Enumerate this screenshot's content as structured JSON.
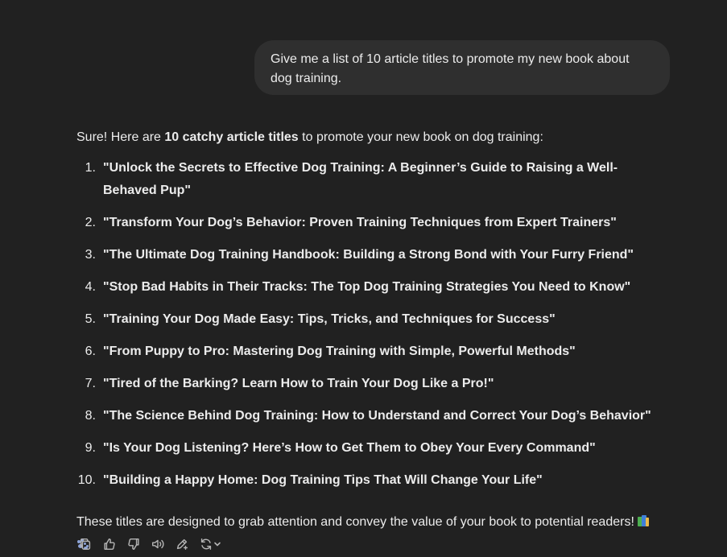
{
  "conversation": {
    "user_message": "Give me a list of 10 article titles to promote my new book about dog training.",
    "assistant": {
      "intro_prefix": "Sure! Here are ",
      "intro_bold": "10 catchy article titles",
      "intro_suffix": " to promote your new book on dog training:",
      "titles": [
        {
          "num": "1.",
          "text": "\"Unlock the Secrets to Effective Dog Training: A Beginner’s Guide to Raising a Well-Behaved Pup\""
        },
        {
          "num": "2.",
          "text": "\"Transform Your Dog’s Behavior: Proven Training Techniques from Expert Trainers\""
        },
        {
          "num": "3.",
          "text": "\"The Ultimate Dog Training Handbook: Building a Strong Bond with Your Furry Friend\""
        },
        {
          "num": "4.",
          "text": "\"Stop Bad Habits in Their Tracks: The Top Dog Training Strategies You Need to Know\""
        },
        {
          "num": "5.",
          "text": "\"Training Your Dog Made Easy: Tips, Tricks, and Techniques for Success\""
        },
        {
          "num": "6.",
          "text": "\"From Puppy to Pro: Mastering Dog Training with Simple, Powerful Methods\""
        },
        {
          "num": "7.",
          "text": "\"Tired of the Barking? Learn How to Train Your Dog Like a Pro!\""
        },
        {
          "num": "8.",
          "text": "\"The Science Behind Dog Training: How to Understand and Correct Your Dog’s Behavior\""
        },
        {
          "num": "9.",
          "text": "\"Is Your Dog Listening? Here’s How to Get Them to Obey Your Every Command\""
        },
        {
          "num": "10.",
          "text": "\"Building a Happy Home: Dog Training Tips That Will Change Your Life\""
        }
      ],
      "outro": "These titles are designed to grab attention and convey the value of your book to potential readers! "
    }
  },
  "action_bar": {
    "icons": [
      "copy-icon",
      "thumbs-up-icon",
      "thumbs-down-icon",
      "read-aloud-icon",
      "edit-canvas-icon",
      "regenerate-icon",
      "chevron-down-icon"
    ]
  },
  "colors": {
    "background": "#212121",
    "user_bubble": "#2f2f2f",
    "text": "#ececec",
    "icon": "#b4b4b4"
  }
}
